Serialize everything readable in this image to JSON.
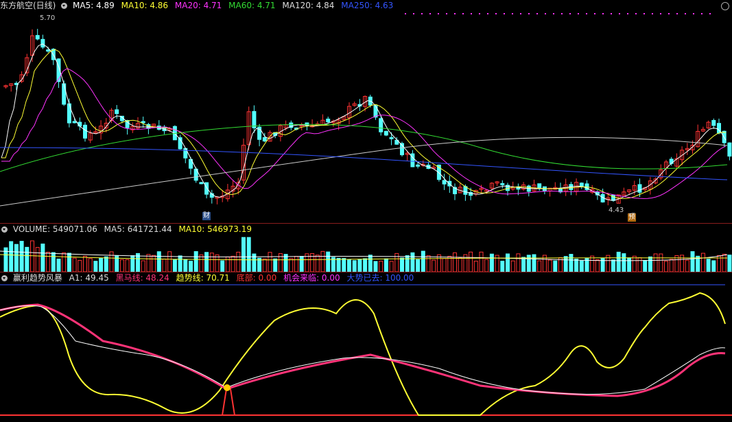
{
  "main": {
    "title": "东方航空(日线)",
    "ma": [
      {
        "label": "MA5: 4.89",
        "color": "#ffffff"
      },
      {
        "label": "MA10: 4.86",
        "color": "#ffff33"
      },
      {
        "label": "MA20: 4.71",
        "color": "#ff33ff"
      },
      {
        "label": "MA60: 4.71",
        "color": "#33dd33"
      },
      {
        "label": "MA120: 4.84",
        "color": "#dddddd"
      },
      {
        "label": "MA250: 4.63",
        "color": "#3355ff"
      }
    ],
    "high_label": "5.70",
    "low_label": "4.43",
    "tag_cai": "财",
    "tag_yu": "预"
  },
  "volume": {
    "title": "VOLUME: 549071.06",
    "ma5": "MA5: 641721.44",
    "ma10": "MA10: 546973.19"
  },
  "indicator": {
    "name": "赢利趋势风暴",
    "a1": "A1: 49.45",
    "heima": "黑马线: 48.24",
    "qushi": "趋势线: 70.71",
    "dibu": "底部: 0.00",
    "jihui": "机会来临: 0.00",
    "dashi": "大势已去: 100.00"
  },
  "colors": {
    "up": "#ff3333",
    "down": "#54ffff",
    "background": "#000000",
    "separator": "#8a1c1c"
  }
}
